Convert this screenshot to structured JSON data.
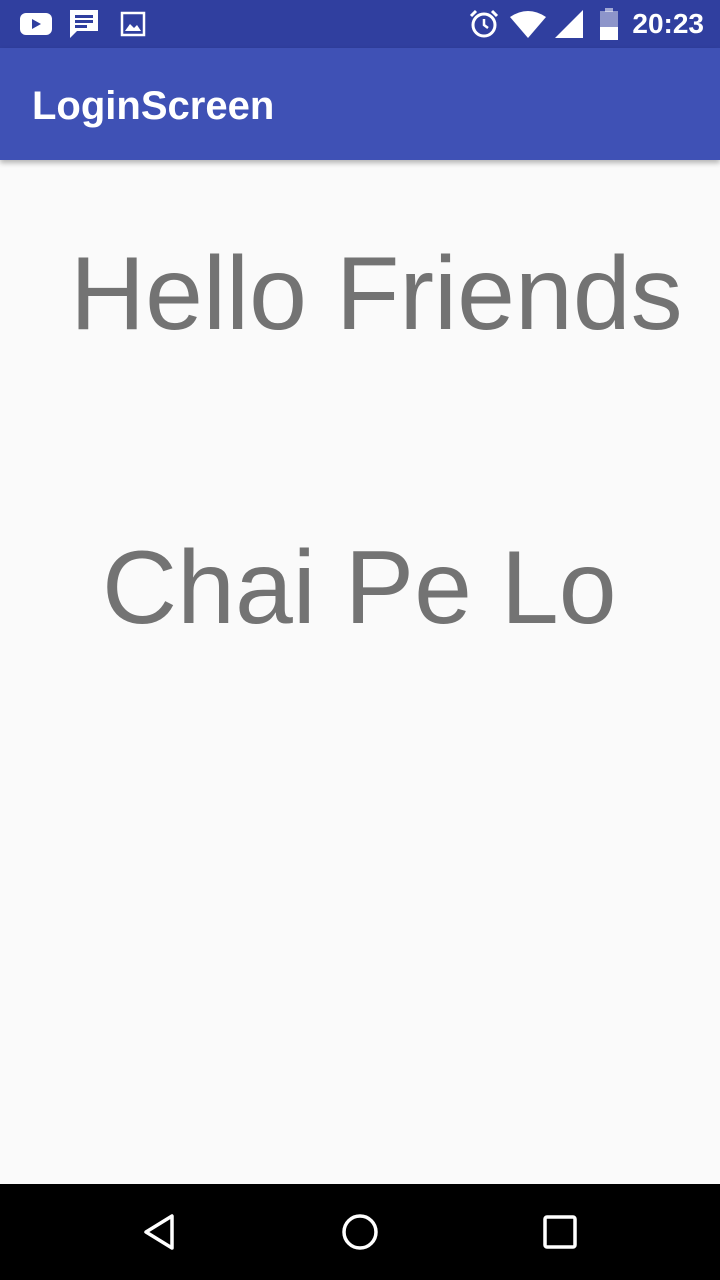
{
  "status_bar": {
    "time": "20:23",
    "left_icons": [
      "youtube-icon",
      "message-icon",
      "image-icon"
    ],
    "right_icons": [
      "alarm-icon",
      "wifi-icon",
      "signal-icon",
      "battery-icon"
    ],
    "background": "#303f9f"
  },
  "app_bar": {
    "title": "LoginScreen",
    "background": "#3f51b5"
  },
  "content": {
    "line1": "Hello Friends",
    "line2": "Chai Pe Lo",
    "text_color": "#737373"
  },
  "nav_bar": {
    "buttons": [
      "back-icon",
      "home-icon",
      "recents-icon"
    ]
  }
}
